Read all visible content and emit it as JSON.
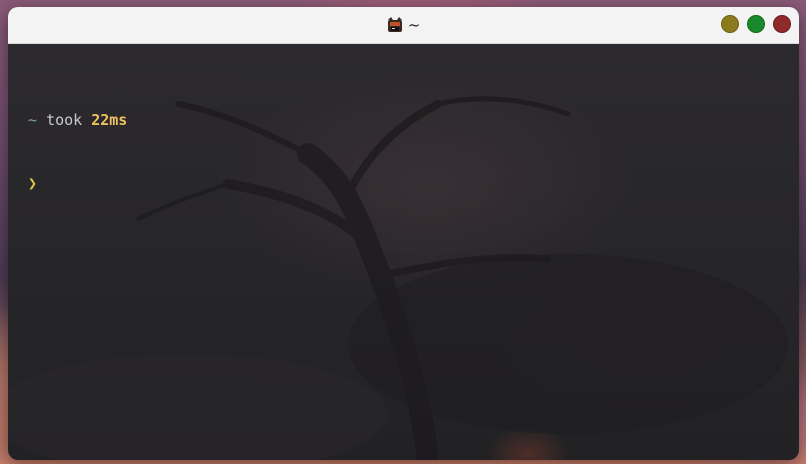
{
  "window": {
    "title": "~",
    "app_icon": "terminal-cat-icon",
    "controls": {
      "minimize_icon": "minimize-icon",
      "maximize_icon": "maximize-icon",
      "close_icon": "close-icon",
      "colors": {
        "minimize": "#8c7a1f",
        "maximize": "#198a2b",
        "close": "#8f2a2c"
      }
    }
  },
  "terminal": {
    "prompt_dir": "~",
    "took_label": "took",
    "duration": "22ms",
    "input_prompt": "❯",
    "colors": {
      "background": "#262528",
      "dir": "#7fa7a2",
      "duration": "#f0c060",
      "prompt": "#d9c84a"
    }
  }
}
